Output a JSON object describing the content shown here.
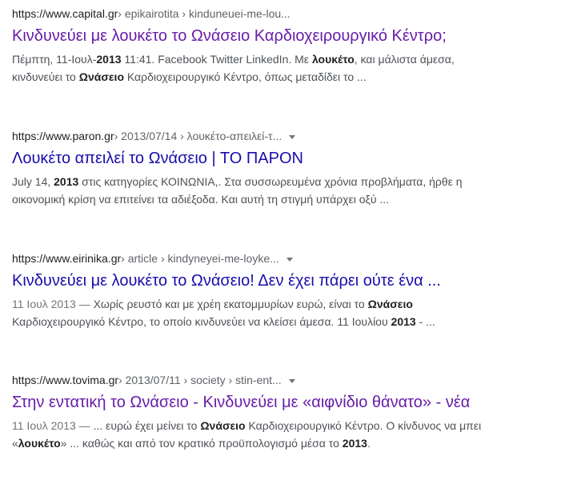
{
  "results": [
    {
      "domain": "https://www.capital.gr",
      "breadcrumb": " › epikairotita › kinduneuei-me-lou...",
      "has_menu": false,
      "title": "Κινδυνεύει με λουκέτο το Ωνάσειο Καρδιοχειρουργικό Κέντρο;",
      "visited": true,
      "snippet": [
        [
          {
            "t": "Πέμπτη, 11-Ιουλ-",
            "b": false
          },
          {
            "t": "2013",
            "b": true
          },
          {
            "t": " 11:41. Facebook Twitter LinkedIn. Με ",
            "b": false
          },
          {
            "t": "λουκέτο",
            "b": true
          },
          {
            "t": ", και μάλιστα άμεσα,",
            "b": false
          }
        ],
        [
          {
            "t": "κινδυνεύει το ",
            "b": false
          },
          {
            "t": "Ωνάσειο",
            "b": true
          },
          {
            "t": " Καρδιοχειρουργικό Κέντρο, όπως μεταδίδει το ...",
            "b": false
          }
        ]
      ]
    },
    {
      "domain": "https://www.paron.gr",
      "breadcrumb": " › 2013/07/14 › λουκέτο-απειλεί-τ...",
      "has_menu": true,
      "title": "Λουκέτο απειλεί το Ωνάσειο | ΤΟ ΠΑΡΟΝ",
      "visited": false,
      "snippet": [
        [
          {
            "t": "July 14, ",
            "b": false
          },
          {
            "t": "2013",
            "b": true
          },
          {
            "t": " στις κατηγορίες ΚΟΙΝΩΝΙΑ,. Στα συσσωρευμένα χρόνια προβλήματα, ήρθε η",
            "b": false
          }
        ],
        [
          {
            "t": "οικονομική κρίση να επιτείνει τα αδιέξοδα. Και αυτή τη στιγμή υπάρχει οξύ ...",
            "b": false
          }
        ]
      ]
    },
    {
      "domain": "https://www.eirinika.gr",
      "breadcrumb": " › article › kindyneyei-me-loyke...",
      "has_menu": true,
      "title": "Κινδυνεύει με λουκέτο το Ωνάσειο! Δεν έχει πάρει ούτε ένα ...",
      "visited": false,
      "snippet": [
        [
          {
            "t": "11 Ιουλ 2013 — ",
            "b": false,
            "date": true
          },
          {
            "t": "Χωρίς ρευστό και με χρέη εκατομμυρίων ευρώ, είναι το ",
            "b": false
          },
          {
            "t": "Ωνάσειο",
            "b": true
          }
        ],
        [
          {
            "t": "Καρδιοχειρουργικό Κέντρο, το οποίο κινδυνεύει να κλείσει άμεσα. 11 Ιουλίου ",
            "b": false
          },
          {
            "t": "2013",
            "b": true
          },
          {
            "t": " - ...",
            "b": false
          }
        ]
      ]
    },
    {
      "domain": "https://www.tovima.gr",
      "breadcrumb": " › 2013/07/11 › society › stin-ent...",
      "has_menu": true,
      "title": "Στην εντατική το Ωνάσειο - Κινδυνεύει με «αιφνίδιο θάνατο» - νέα",
      "visited": true,
      "snippet": [
        [
          {
            "t": "11 Ιουλ 2013 — ",
            "b": false,
            "date": true
          },
          {
            "t": "... ευρώ έχει μείνει το ",
            "b": false
          },
          {
            "t": "Ωνάσειο",
            "b": true
          },
          {
            "t": " Καρδιοχειρουργικό Κέντρο. Ο κίνδυνος να μπει",
            "b": false
          }
        ],
        [
          {
            "t": "«",
            "b": false
          },
          {
            "t": "λουκέτο",
            "b": true
          },
          {
            "t": "» ... καθώς και από τον κρατικό προϋπολογισμό μέσα το ",
            "b": false
          },
          {
            "t": "2013",
            "b": true
          },
          {
            "t": ".",
            "b": false
          }
        ]
      ]
    }
  ]
}
